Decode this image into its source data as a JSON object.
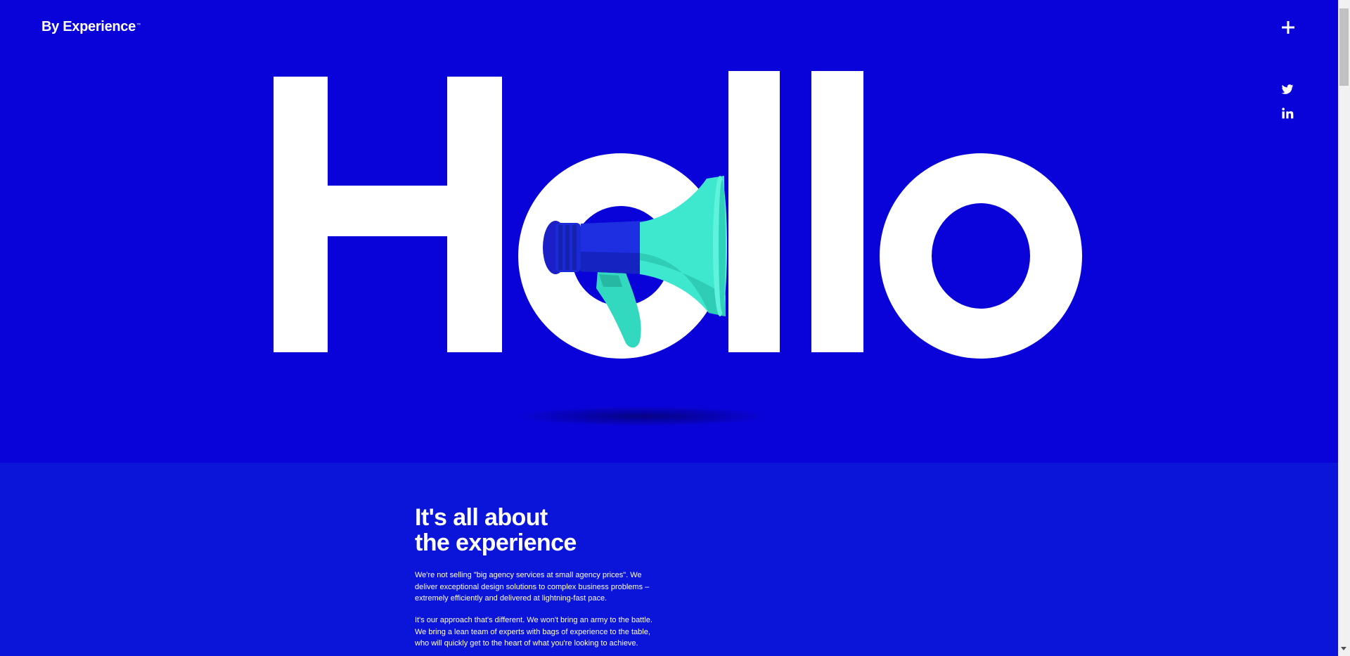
{
  "header": {
    "logo_text": "By Experience",
    "logo_tm": "™",
    "menu_icon": "plus-icon"
  },
  "social": {
    "items": [
      "twitter-icon",
      "linkedin-icon"
    ]
  },
  "hero": {
    "word": "Hello",
    "letters": [
      "H",
      "e",
      "l",
      "l",
      "o"
    ],
    "image": "megaphone",
    "colors": {
      "background": "#0a03d9",
      "text": "#ffffff",
      "megaphone_bell": "#3ee8cf",
      "megaphone_body": "#1a2ad6"
    }
  },
  "about": {
    "title_line1": "It's all about",
    "title_line2": "the experience",
    "paragraph1": "We're not selling \"big agency services at small agency prices\". We deliver exceptional design solutions to complex business problems – extremely efficiently and delivered at lightning-fast pace.",
    "paragraph2": "It's our approach that's different. We won't bring an army to the battle. We bring a lean team of experts with bags of experience to the table, who will quickly get to the heart of what you're looking to achieve."
  },
  "colors": {
    "accent": "#0a03d9",
    "section_bg": "#0b14d9",
    "text": "#ffffff"
  }
}
